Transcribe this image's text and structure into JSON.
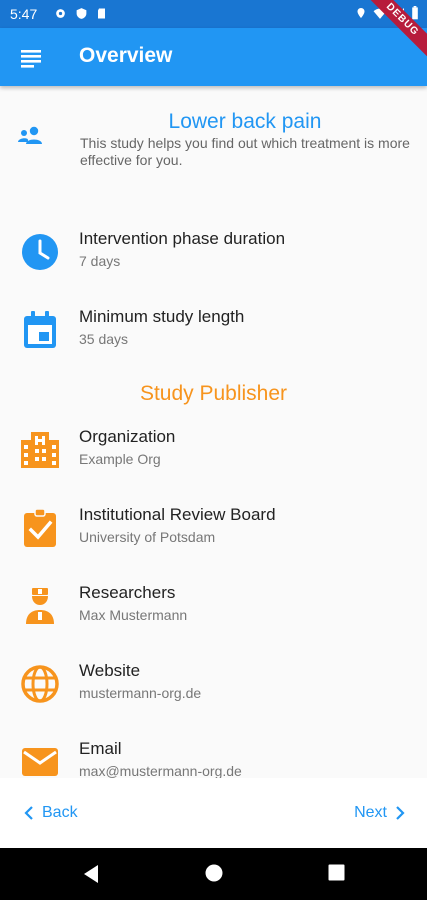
{
  "status_bar": {
    "time": "5:47"
  },
  "debug_banner": "DEBUG",
  "app_bar": {
    "title": "Overview"
  },
  "study": {
    "title": "Lower back pain",
    "description": "This study helps you find out which treatment is more effective for you."
  },
  "study_details": [
    {
      "title": "Intervention phase duration",
      "value": "7 days",
      "icon": "clock-icon"
    },
    {
      "title": "Minimum study length",
      "value": "35 days",
      "icon": "calendar-icon"
    }
  ],
  "publisher": {
    "heading": "Study Publisher",
    "items": [
      {
        "title": "Organization",
        "value": "Example Org",
        "icon": "building-icon"
      },
      {
        "title": "Institutional Review Board",
        "value": "University of Potsdam",
        "icon": "clipboard-check-icon"
      },
      {
        "title": "Researchers",
        "value": "Max Mustermann",
        "icon": "researcher-icon"
      },
      {
        "title": "Website",
        "value": "mustermann-org.de",
        "icon": "globe-icon"
      },
      {
        "title": "Email",
        "value": "max@mustermann-org.de",
        "icon": "mail-icon"
      }
    ]
  },
  "navigation": {
    "back": "Back",
    "next": "Next"
  },
  "colors": {
    "primary": "#2196f3",
    "status_bar": "#1976d2",
    "accent": "#f7941d"
  }
}
